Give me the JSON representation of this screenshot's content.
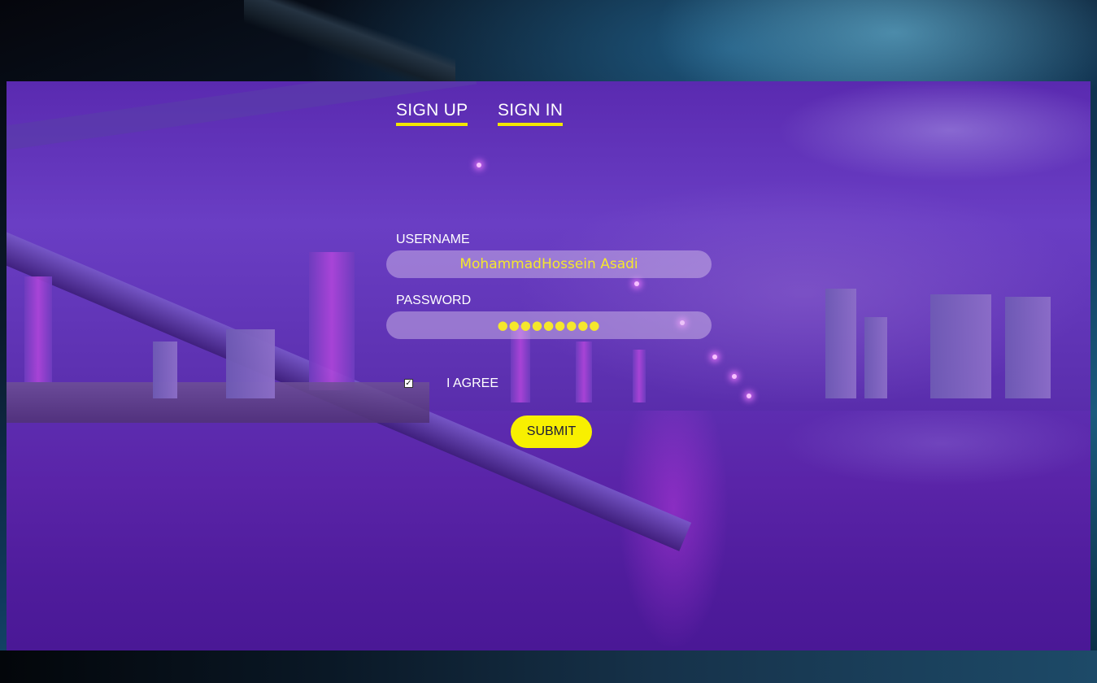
{
  "tabs": {
    "signup_label": "SIGN UP",
    "signin_label": "SIGN IN"
  },
  "form": {
    "username_label": "USERNAME",
    "username_value": "MohammadHossein Asadi",
    "password_label": "PASSWORD",
    "password_value": "●●●●●●●●●",
    "agree_label": "I AGREE",
    "agree_checked": true,
    "submit_label": "SUBMIT"
  },
  "colors": {
    "accent": "#f2e600",
    "field_text": "#f5e72c",
    "overlay": "#5a2ab0"
  }
}
